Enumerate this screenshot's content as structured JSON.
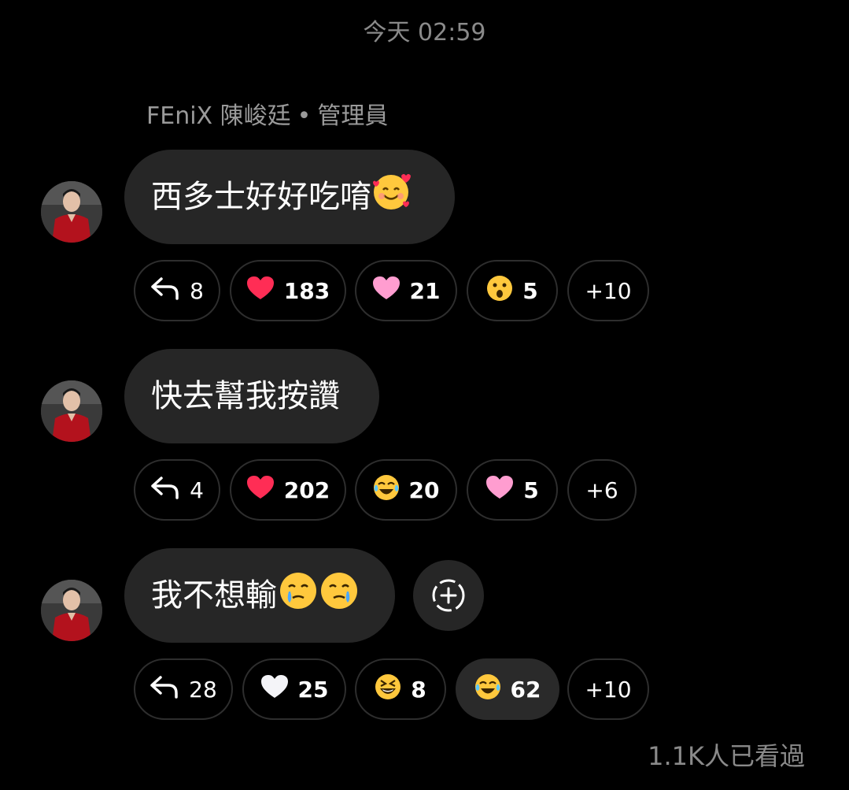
{
  "header": {
    "timestamp": "今天 02:59"
  },
  "sender": {
    "name": "FEniX 陳峻廷",
    "separator": "•",
    "role": "管理員"
  },
  "messages": [
    {
      "text": "西多士好好吃唷",
      "emoji": "smiling-face-with-hearts",
      "reactions": {
        "reply_count": "8",
        "items": [
          {
            "emoji": "red-heart",
            "count": "183"
          },
          {
            "emoji": "pink-heart",
            "count": "21"
          },
          {
            "emoji": "surprised-face",
            "count": "5"
          }
        ],
        "more": "+10"
      }
    },
    {
      "text": "快去幫我按讚",
      "reactions": {
        "reply_count": "4",
        "items": [
          {
            "emoji": "red-heart",
            "count": "202"
          },
          {
            "emoji": "tears-of-joy",
            "count": "20"
          },
          {
            "emoji": "pink-heart",
            "count": "5"
          }
        ],
        "more": "+6"
      }
    },
    {
      "text": "我不想輸",
      "emoji": "face-holding-back-tears",
      "reactions": {
        "reply_count": "28",
        "items": [
          {
            "emoji": "white-heart",
            "count": "25"
          },
          {
            "emoji": "grinning-squinting-face",
            "count": "8"
          },
          {
            "emoji": "tears-of-joy",
            "count": "62",
            "selected": true
          }
        ],
        "more": "+10"
      }
    }
  ],
  "footer": {
    "seen": "1.1K人已看過"
  },
  "colors": {
    "background": "#000000",
    "bubble": "#262626",
    "pill_border": "#2e2e2e",
    "muted_text": "#8a8a8a",
    "red_heart": "#ff2d55",
    "pink_heart": "#ff9dd0",
    "emoji_yellow": "#ffc83d"
  }
}
